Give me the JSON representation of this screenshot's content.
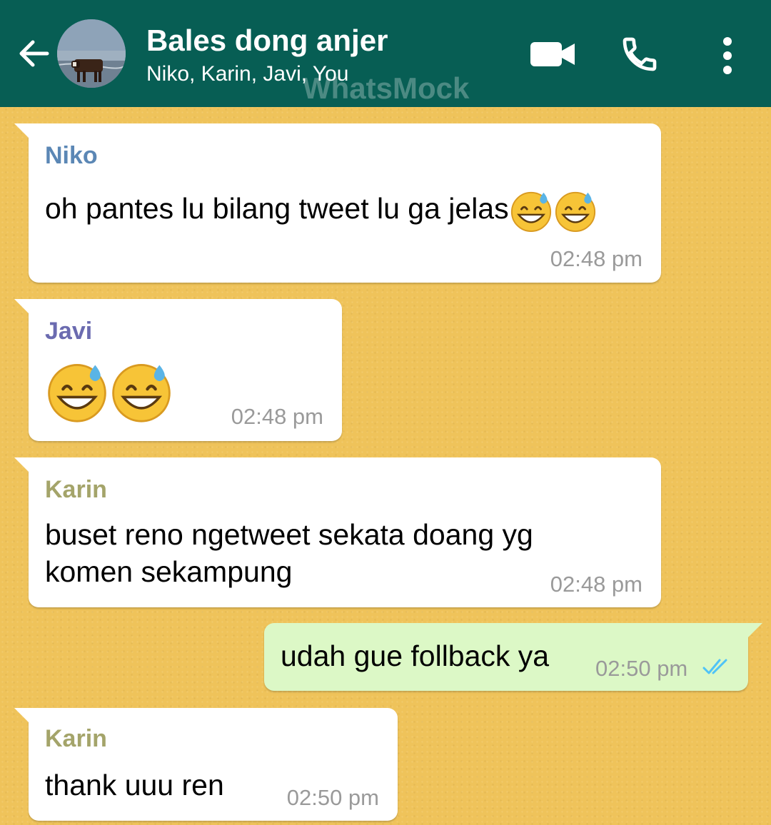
{
  "header": {
    "title": "Bales dong anjer",
    "participants": "Niko, Karin, Javi, You",
    "watermark": "WhatsMock",
    "icons": {
      "back": "arrow-left-icon",
      "video": "video-camera-icon",
      "call": "phone-icon",
      "menu": "more-vertical-icon"
    },
    "color": "#075e54"
  },
  "colors": {
    "wallpaper": "#efc35a",
    "incoming_bubble": "#ffffff",
    "outgoing_bubble": "#dcf8c6",
    "niko": "#5b87b5",
    "javi": "#6b6bb0",
    "karin": "#a4a46a",
    "read_ticks": "#4fc3f7"
  },
  "messages": [
    {
      "sender": "Niko",
      "text": "oh pantes lu bilang tweet lu ga jelas",
      "emoji": [
        "grinning-face-with-sweat",
        "grinning-face-with-sweat"
      ],
      "time": "02:48 pm",
      "direction": "incoming"
    },
    {
      "sender": "Javi",
      "text": "",
      "emoji": [
        "grinning-face-with-sweat",
        "grinning-face-with-sweat"
      ],
      "time": "02:48 pm",
      "direction": "incoming"
    },
    {
      "sender": "Karin",
      "text_line1": "buset reno ngetweet sekata doang yg",
      "text_line2": "komen sekampung",
      "time": "02:48 pm",
      "direction": "incoming"
    },
    {
      "sender": "You",
      "text": "udah gue follback ya",
      "time": "02:50 pm",
      "status": "read",
      "direction": "outgoing"
    },
    {
      "sender": "Karin",
      "text": "thank uuu ren",
      "time": "02:50 pm",
      "direction": "incoming"
    }
  ]
}
